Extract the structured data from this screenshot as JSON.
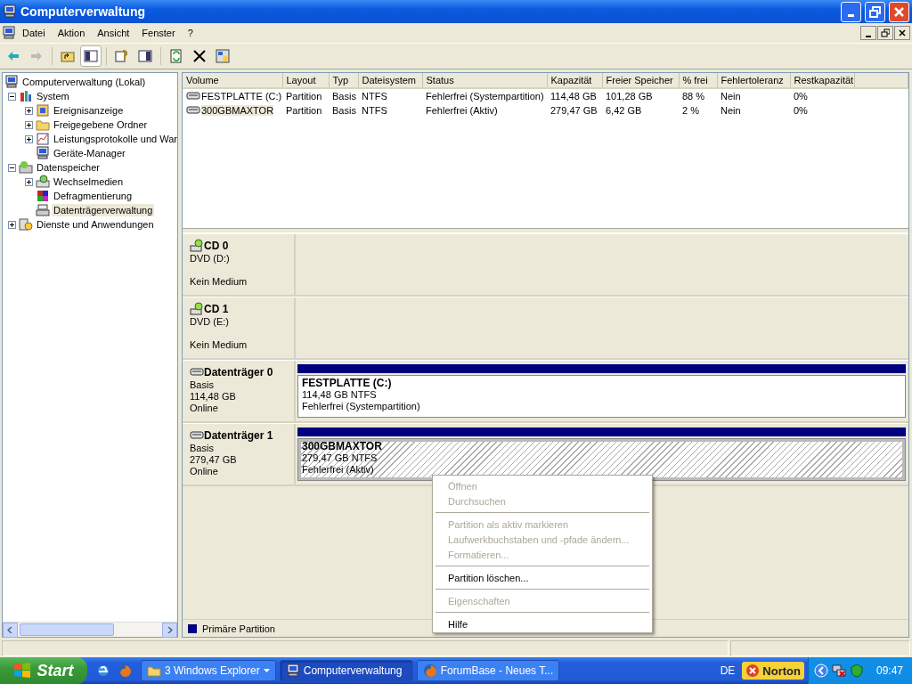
{
  "window": {
    "title": "Computerverwaltung"
  },
  "menu": [
    "Datei",
    "Aktion",
    "Ansicht",
    "Fenster",
    "?"
  ],
  "toolbar": [
    {
      "kind": "back",
      "disabled": false,
      "pressed": false
    },
    {
      "kind": "forward",
      "disabled": true,
      "pressed": false
    },
    {
      "kind": "separator"
    },
    {
      "kind": "up",
      "disabled": false,
      "pressed": false
    },
    {
      "kind": "tree",
      "disabled": false,
      "pressed": true
    },
    {
      "kind": "separator"
    },
    {
      "kind": "help",
      "disabled": false,
      "pressed": false
    },
    {
      "kind": "panel",
      "disabled": false,
      "pressed": false
    },
    {
      "kind": "separator"
    },
    {
      "kind": "refresh",
      "disabled": false,
      "pressed": false
    },
    {
      "kind": "delete",
      "disabled": false,
      "pressed": false
    },
    {
      "kind": "properties",
      "disabled": false,
      "pressed": false
    }
  ],
  "tree": [
    {
      "label": "Computerverwaltung (Lokal)",
      "kind": "computer",
      "selected": false,
      "children": [
        {
          "label": "System",
          "kind": "tools",
          "expanded": true,
          "selected": false,
          "children": [
            {
              "label": "Ereignisanzeige",
              "kind": "log",
              "expanded": false,
              "selected": false
            },
            {
              "label": "Freigegebene Ordner",
              "kind": "folder",
              "expanded": false,
              "selected": false
            },
            {
              "label": "Leistungsprotokolle und War",
              "kind": "chart",
              "expanded": false,
              "selected": false
            },
            {
              "label": "Geräte-Manager",
              "kind": "computer",
              "selected": false
            }
          ]
        },
        {
          "label": "Datenspeicher",
          "kind": "storage",
          "expanded": true,
          "selected": false,
          "children": [
            {
              "label": "Wechselmedien",
              "kind": "media",
              "expanded": false,
              "selected": false
            },
            {
              "label": "Defragmentierung",
              "kind": "defrag",
              "selected": false
            },
            {
              "label": "Datenträgerverwaltung",
              "kind": "drive",
              "selected": true
            }
          ]
        },
        {
          "label": "Dienste und Anwendungen",
          "kind": "services",
          "expanded": false,
          "selected": false
        }
      ]
    }
  ],
  "table": {
    "columns": [
      "Volume",
      "Layout",
      "Typ",
      "Dateisystem",
      "Status",
      "Kapazität",
      "Freier Speicher",
      "% frei",
      "Fehlertoleranz",
      "Restkapazität"
    ],
    "rows": [
      {
        "selected": false,
        "cells": [
          "FESTPLATTE (C:)",
          "Partition",
          "Basis",
          "NTFS",
          "Fehlerfrei (Systempartition)",
          "114,48 GB",
          "101,28 GB",
          "88 %",
          "Nein",
          "0%"
        ]
      },
      {
        "selected": true,
        "cells": [
          "300GBMAXTOR",
          "Partition",
          "Basis",
          "NTFS",
          "Fehlerfrei (Aktiv)",
          "279,47 GB",
          "6,42 GB",
          "2 %",
          "Nein",
          "0%"
        ]
      }
    ]
  },
  "disks": [
    {
      "kind": "cd",
      "name": "CD 0",
      "type": "DVD (D:)",
      "status": "Kein Medium"
    },
    {
      "kind": "cd",
      "name": "CD 1",
      "type": "DVD (E:)",
      "status": "Kein Medium"
    },
    {
      "kind": "disk",
      "name": "Datenträger 0",
      "type": "Basis",
      "size": "114,48 GB",
      "status": "Online",
      "partitions": [
        {
          "name": "FESTPLATTE  (C:)",
          "size": "114,48 GB NTFS",
          "status": "Fehlerfrei (Systempartition)",
          "selected": false
        }
      ]
    },
    {
      "kind": "disk",
      "name": "Datenträger 1",
      "type": "Basis",
      "size": "279,47 GB",
      "status": "Online",
      "partitions": [
        {
          "name": "300GBMAXTOR",
          "size": "279,47 GB NTFS",
          "status": "Fehlerfrei (Aktiv)",
          "selected": true
        }
      ]
    }
  ],
  "legend": [
    {
      "label": "Primäre Partition",
      "color": "#000080"
    }
  ],
  "context_menu": [
    {
      "kind": "item",
      "label": "Öffnen",
      "disabled": true
    },
    {
      "kind": "item",
      "label": "Durchsuchen",
      "disabled": true
    },
    {
      "kind": "separator"
    },
    {
      "kind": "item",
      "label": "Partition als aktiv markieren",
      "disabled": true
    },
    {
      "kind": "item",
      "label": "Laufwerkbuchstaben und -pfade ändern...",
      "disabled": true
    },
    {
      "kind": "item",
      "label": "Formatieren...",
      "disabled": true
    },
    {
      "kind": "separator"
    },
    {
      "kind": "item",
      "label": "Partition löschen...",
      "disabled": false
    },
    {
      "kind": "separator"
    },
    {
      "kind": "item",
      "label": "Eigenschaften",
      "disabled": true
    },
    {
      "kind": "separator"
    },
    {
      "kind": "item",
      "label": "Hilfe",
      "disabled": false
    }
  ],
  "taskbar": {
    "start": "Start",
    "quick_launch": [
      {
        "kind": "ie"
      },
      {
        "kind": "firefox"
      }
    ],
    "tasks": [
      {
        "label": "3 Windows Explorer",
        "kind": "folder",
        "selected": false,
        "group": true
      },
      {
        "label": "Computerverwaltung",
        "kind": "computer",
        "selected": true,
        "group": false
      },
      {
        "label": "ForumBase - Neues T...",
        "kind": "firefox",
        "selected": false,
        "group": false
      }
    ],
    "language": "DE",
    "norton": "Norton",
    "tray_icons": [
      {
        "kind": "back"
      },
      {
        "kind": "network"
      },
      {
        "kind": "shield"
      }
    ],
    "clock": "09:47"
  }
}
